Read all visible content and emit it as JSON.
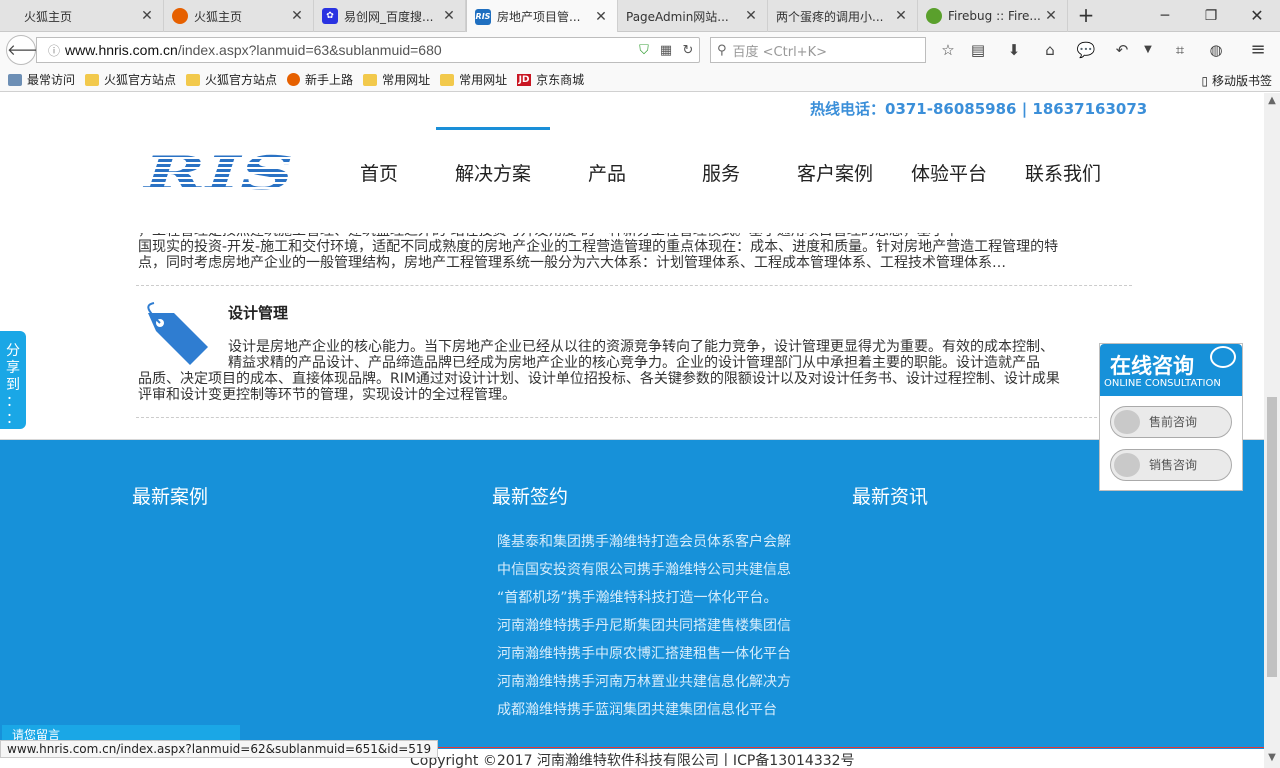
{
  "browser": {
    "tabs": [
      {
        "title": "火狐主页",
        "icon": "none-icon"
      },
      {
        "title": "火狐主页",
        "icon": "firefox-icon"
      },
      {
        "title": "易创网_百度搜...",
        "icon": "baidu-paw-icon"
      },
      {
        "title": "房地产项目管...",
        "icon": "ris-icon"
      },
      {
        "title": "PageAdmin网站...",
        "icon": "none-icon"
      },
      {
        "title": "两个蛋疼的调用小...",
        "icon": "none-icon"
      },
      {
        "title": "Firebug :: Fire...",
        "icon": "firebug-icon"
      }
    ],
    "url": {
      "host": "www.hnris.com.cn",
      "path": "/index.aspx?lanmuid=63&sublanmuid=680"
    },
    "search_placeholder": "百度 <Ctrl+K>",
    "bookmarks": [
      "最常访问",
      "火狐官方站点",
      "火狐官方站点",
      "新手上路",
      "常用网址",
      "常用网址",
      "京东商城"
    ],
    "mobile_bookmarks": "移动版书签",
    "status_url": "www.hnris.com.cn/index.aspx?lanmuid=62&sublanmuid=651&id=519"
  },
  "site": {
    "hotline": "热线电话：0371-86085986 | 18637163073",
    "logo_text": "RIS",
    "nav": [
      "首页",
      "解决方案",
      "产品",
      "服务",
      "客户案例",
      "体验平台",
      "联系我们"
    ],
    "article1_tail": {
      "line1": "，工程管理是按照建筑施工管理、建筑监理之外的 站在投资与开发角度 的一种新分工程管理模式。基于通用项目管理的思想，基于中",
      "line2": "国现实的投资-开发-施工和交付环境，适配不同成熟度的房地产企业的工程营造管理的重点体现在：成本、进度和质量。针对房地产营造工程管理的特",
      "line3": "点，同时考虑房地产企业的一般管理结构，房地产工程管理系统一般分为六大体系：计划管理体系、工程成本管理体系、工程技术管理体系…"
    },
    "article2": {
      "title": "设计管理",
      "line1": "设计是房地产企业的核心能力。当下房地产企业已经从以往的资源竞争转向了能力竞争，设计管理更显得尤为重要。有效的成本控制、",
      "line2": "精益求精的产品设计、产品缔造品牌已经成为房地产企业的核心竞争力。企业的设计管理部门从中承担着主要的职能。设计造就产品",
      "line3": "品质、决定项目的成本、直接体现品牌。RIM通过对设计计划、设计单位招投标、各关键参数的限额设计以及对设计任务书、设计过程控制、设计成果",
      "line4": "评审和设计变更控制等环节的管理，实现设计的全过程管理。"
    },
    "footer": {
      "col1_title": "最新案例",
      "col2_title": "最新签约",
      "col3_title": "最新资讯",
      "signings": [
        "隆基泰和集团携手瀚维特打造会员体系客户会解",
        "中信国安投资有限公司携手瀚维特公司共建信息",
        "“首都机场”携手瀚维特科技打造一体化平台。",
        "河南瀚维特携手丹尼斯集团共同搭建售楼集团信",
        "河南瀚维特携手中原农博汇搭建租售一体化平台",
        "河南瀚维特携手河南万林置业共建信息化解决方",
        "成都瀚维特携手蓝润集团共建集团信息化平台"
      ],
      "copyright": "Copyright ©2017 河南瀚维特软件科技有限公司丨ICP备13014332号"
    },
    "share_tab": [
      "分",
      "享",
      "到",
      "：",
      "："
    ],
    "consult": {
      "title": "在线咨询",
      "subtitle": "ONLINE CONSULTATION",
      "presale": "售前咨询",
      "sales": "销售咨询"
    },
    "chat_strip": "请您留言"
  }
}
